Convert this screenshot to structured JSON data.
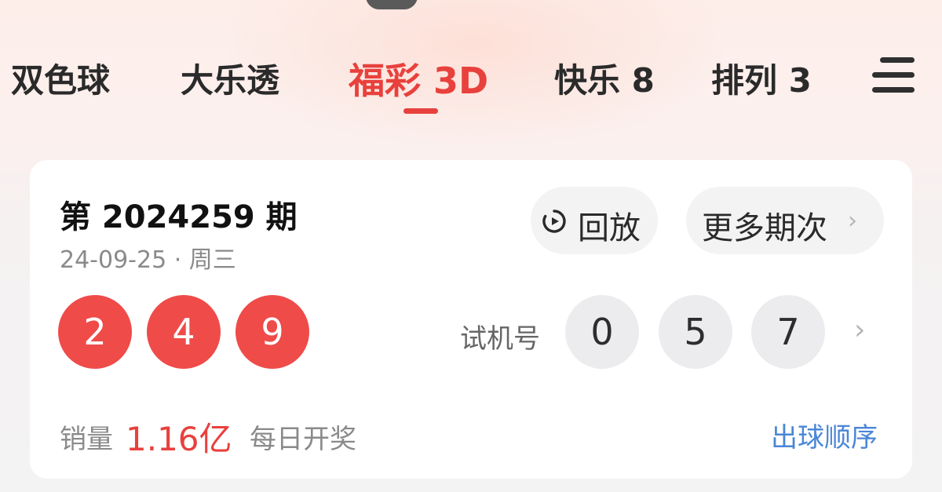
{
  "tabs": [
    {
      "label": "双色球",
      "active": false
    },
    {
      "label": "大乐透",
      "active": false
    },
    {
      "label": "福彩 3D",
      "active": true
    },
    {
      "label": "快乐 8",
      "active": false
    },
    {
      "label": "排列 3",
      "active": false
    }
  ],
  "draw": {
    "period": "第 2024259 期",
    "date": "24-09-25 · 周三",
    "replay_label": "回放",
    "more_label": "更多期次",
    "more_chevron": "›",
    "numbers": [
      "2",
      "4",
      "9"
    ],
    "test_label": "试机号",
    "test_numbers": [
      "0",
      "5",
      "7"
    ],
    "test_chevron": "›",
    "sales_label": "销量",
    "sales_value": "1.16亿",
    "frequency": "每日开奖",
    "order_link": "出球顺序"
  },
  "colors": {
    "accent_red": "#e8413d",
    "ball_red": "#ef4b49",
    "ball_gray": "#ececee",
    "link_blue": "#4a86d6"
  },
  "icons": {
    "menu": "menu-icon",
    "replay": "replay-icon",
    "chevron": "chevron-right-icon"
  }
}
